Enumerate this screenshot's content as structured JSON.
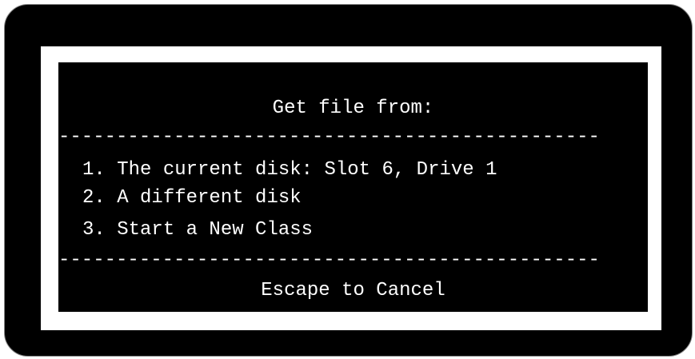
{
  "dialog": {
    "title": "Get file from:",
    "separator": "-----------------------------------------------",
    "options": [
      {
        "label": "1. The current disk: Slot 6, Drive 1"
      },
      {
        "label": "2. A different disk"
      },
      {
        "label": "3. Start a New Class"
      }
    ],
    "footer": "Escape to Cancel"
  },
  "colors": {
    "background": "#000000",
    "text": "#ffffff",
    "frame": "#ffffff"
  }
}
